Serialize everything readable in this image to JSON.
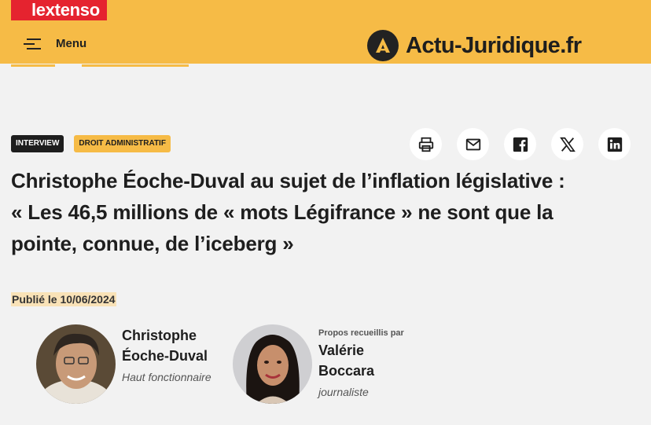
{
  "header": {
    "group_brand": "lextenso",
    "menu_label": "Menu",
    "site_name": "Actu-Juridique.fr"
  },
  "article": {
    "tags": [
      "INTERVIEW",
      "DROIT ADMINISTRATIF"
    ],
    "share_icons": [
      "print-icon",
      "email-icon",
      "facebook-icon",
      "x-icon",
      "linkedin-icon"
    ],
    "title_lines": [
      "Christophe Éoche-Duval au sujet de l’inflation législative :",
      "« Les 46,5 millions de « mots Légifrance » ne sont que la",
      "pointe, connue, de l’iceberg »"
    ],
    "published": "Publié le 10/06/2024"
  },
  "people": [
    {
      "overline": "",
      "name_line1": "Christophe",
      "name_line2": "Éoche-Duval",
      "role": "Haut fonctionnaire"
    },
    {
      "overline": "Propos recueillis par",
      "name_line1": "Valérie",
      "name_line2": "Boccara",
      "role": "journaliste"
    }
  ],
  "colors": {
    "accent_yellow": "#f6bb46",
    "lextenso_red": "#e5232f",
    "text_dark": "#1e1e1e",
    "background": "#f2f2f2"
  }
}
